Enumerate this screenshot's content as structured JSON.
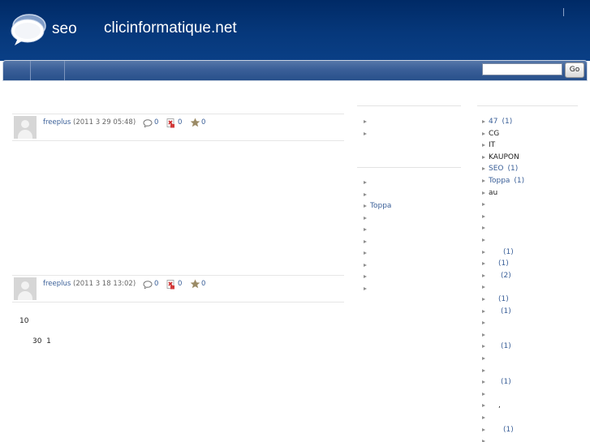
{
  "header": {
    "seo_text": "seo",
    "site_name": "clicinformatique.net",
    "separator": "|"
  },
  "search": {
    "value": "",
    "go_label": "Go"
  },
  "posts": [
    {
      "author": "freeplus",
      "date": "(2011 3 29  05:48)",
      "comments": "0",
      "trackbacks": "0",
      "stars": "0"
    },
    {
      "author": "freeplus",
      "date": "(2011 3 18  13:02)",
      "comments": "0",
      "trackbacks": "0",
      "stars": "0"
    }
  ],
  "post2_body": {
    "line1": "10",
    "line2": "30  1"
  },
  "middle_column": {
    "list_a": [
      "",
      ""
    ],
    "list_b": [
      "",
      "",
      "Toppa",
      "",
      "",
      "",
      "",
      "",
      "",
      ""
    ]
  },
  "right_column": {
    "items": [
      {
        "name": "47",
        "count": "(1)"
      },
      {
        "name": "CG",
        "count": ""
      },
      {
        "name": "IT",
        "count": ""
      },
      {
        "name": "KAUPON",
        "count": ""
      },
      {
        "name": "SEO",
        "count": "(1)"
      },
      {
        "name": "Toppa",
        "count": "(1)"
      },
      {
        "name": "au",
        "count": ""
      },
      {
        "name": "",
        "count": ""
      },
      {
        "name": "",
        "count": ""
      },
      {
        "name": "",
        "count": ""
      },
      {
        "name": "",
        "count": ""
      },
      {
        "name": "",
        "count": "(1)"
      },
      {
        "name": "",
        "count": "(1)"
      },
      {
        "name": "",
        "count": "(2)"
      },
      {
        "name": "",
        "count": ""
      },
      {
        "name": "",
        "count": "(1)"
      },
      {
        "name": "",
        "count": "(1)"
      },
      {
        "name": "",
        "count": ""
      },
      {
        "name": "",
        "count": ""
      },
      {
        "name": "",
        "count": "(1)"
      },
      {
        "name": "",
        "count": ""
      },
      {
        "name": "",
        "count": ""
      },
      {
        "name": "",
        "count": "(1)"
      },
      {
        "name": "",
        "count": ""
      },
      {
        "name": "",
        "count": ","
      },
      {
        "name": "",
        "count": ""
      },
      {
        "name": "",
        "count": "(1)"
      },
      {
        "name": "",
        "count": ""
      }
    ]
  },
  "colors": {
    "header_bg": "#06387b",
    "nav_bg": "#3a5f98",
    "link": "#3a5f98"
  },
  "icons": [
    "speech-bubble-logo-icon",
    "comment-icon",
    "trackback-icon",
    "star-icon",
    "bullet-arrow-icon"
  ]
}
